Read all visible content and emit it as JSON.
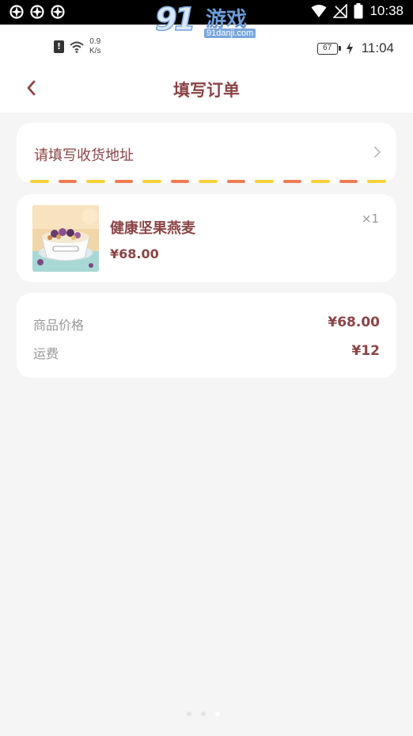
{
  "system_bar": {
    "time": "10:38",
    "notification_icons": [
      "app-notification-icon",
      "app-notification-icon",
      "app-notification-icon"
    ]
  },
  "watermark": {
    "brand_number": "91",
    "brand_name": "游戏",
    "url": "91danji.com"
  },
  "inner_status": {
    "net_speed_value": "0.9",
    "net_speed_unit": "K/s",
    "battery_level": "67",
    "time": "11:04"
  },
  "header": {
    "title": "填写订单"
  },
  "address": {
    "placeholder": "请填写收货地址"
  },
  "product": {
    "name": "健康坚果燕麦",
    "price": "¥68.00",
    "quantity": "×1"
  },
  "summary": {
    "goods_price_label": "商品价格",
    "goods_price_value": "¥68.00",
    "shipping_label": "运费",
    "shipping_value": "¥12"
  },
  "colors": {
    "accent": "#8b4446",
    "dash_yellow": "#f5d23a",
    "dash_orange": "#ee7b53",
    "background": "#f5f5f5"
  },
  "page_indicator": {
    "count": 3,
    "active_index": 2
  }
}
